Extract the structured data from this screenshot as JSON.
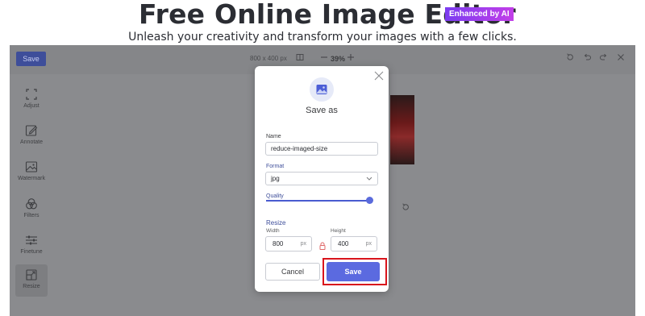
{
  "hero": {
    "title": "Free Online Image Editor",
    "badge": "Enhanced by AI",
    "subtitle": "Unleash your creativity and transform your images with a few clicks."
  },
  "toolbar": {
    "save_label": "Save",
    "dimensions": "800 x 400 px",
    "zoom": "39%",
    "zoom_out_icon": "minus-icon",
    "zoom_in_icon": "plus-icon",
    "actions": [
      "undo-all-icon",
      "undo-icon",
      "redo-icon",
      "close-icon"
    ]
  },
  "sidebar": {
    "items": [
      {
        "label": "Adjust",
        "icon": "crop-icon"
      },
      {
        "label": "Annotate",
        "icon": "pen-icon"
      },
      {
        "label": "Watermark",
        "icon": "image-icon"
      },
      {
        "label": "Filters",
        "icon": "filters-icon"
      },
      {
        "label": "Finetune",
        "icon": "sliders-icon"
      },
      {
        "label": "Resize",
        "icon": "resize-icon",
        "active": true
      }
    ]
  },
  "modal": {
    "title": "Save as",
    "icon": "image-icon",
    "name_label": "Name",
    "name_value": "reduce-imaged-size",
    "format_label": "Format",
    "format_value": "jpg",
    "quality_label": "Quality",
    "quality_value": 1.0,
    "resize_label": "Resize",
    "width_label": "Width",
    "width_value": "800",
    "height_label": "Height",
    "height_value": "400",
    "unit": "px",
    "cancel_label": "Cancel",
    "save_label": "Save"
  },
  "colors": {
    "accent": "#5b6ae0",
    "highlight": "#d9141c",
    "badge_start": "#7b3cf0",
    "badge_end": "#c23fe8"
  }
}
